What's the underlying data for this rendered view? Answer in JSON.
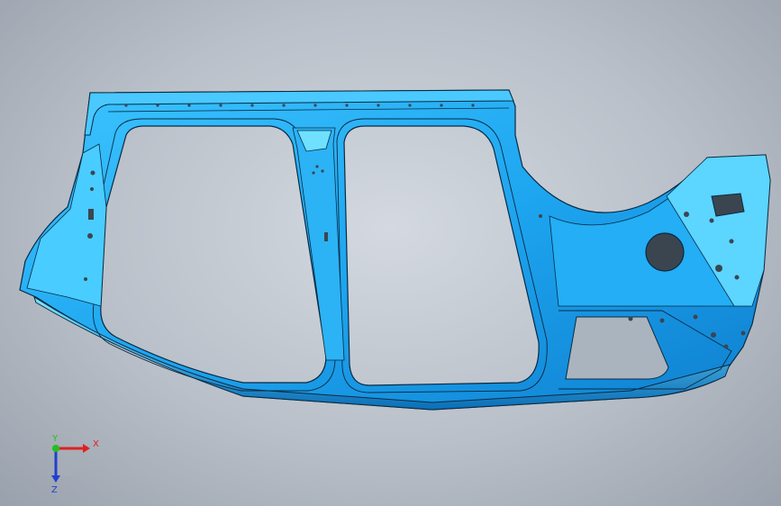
{
  "viewport": {
    "model_name": "",
    "colors": {
      "background_center": "#d4d9e0",
      "background_edge": "#99a1ac",
      "part_fill": "#1ea6f0",
      "part_light": "#5fd8ff",
      "part_dark": "#0b6fb8",
      "edge_line": "#0a2a44",
      "hole": "#3b4550"
    }
  },
  "triad": {
    "x_label": "X",
    "y_label": "Y",
    "z_label": "Z",
    "x_color": "#e02020",
    "y_color": "#20c020",
    "z_color": "#2040d0"
  }
}
